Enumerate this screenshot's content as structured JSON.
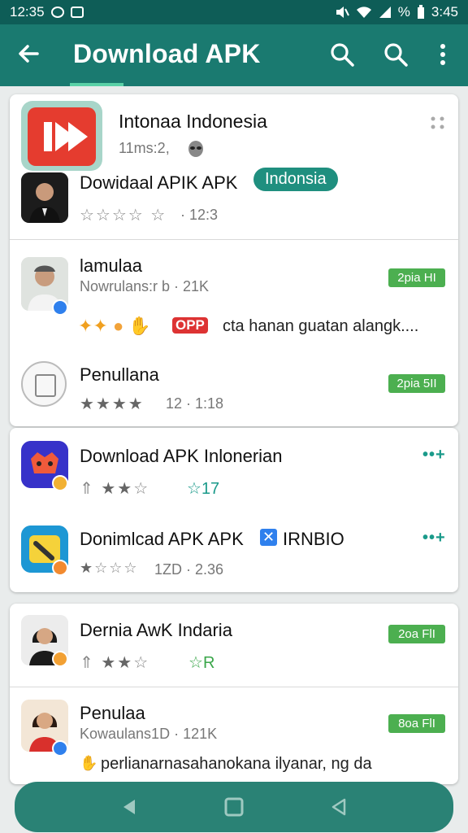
{
  "status": {
    "time": "12:35",
    "right_time": "3:45",
    "battery_label": "%"
  },
  "appbar": {
    "title": "Download APK"
  },
  "card1": {
    "app_title": "Intonaa Indonesia",
    "app_meta": "11ms:2,",
    "row1_title": "Dowidaal APIK APK",
    "row1_pill": "Indonsia",
    "row1_rating": "· 12:3"
  },
  "card1b": {
    "row2_title": "lamulaa",
    "row2_sub": "Nowrulans:r b · 21K",
    "row2_badge": "2pia HI",
    "row2_emoji_text": "cta hanan guatan alangk....",
    "row2_emoji_tag": "OPP",
    "row3_title": "Penullana",
    "row3_badge": "2pia 5II",
    "row3_rating": "12 · 1:18"
  },
  "card2": {
    "row1_title": "Download APK Inlonerian",
    "row1_rating": "17",
    "row2_title": "Donimlcad APK APK",
    "row2_tag": "IRNBIO",
    "row2_rating": "1ZD · 2.36"
  },
  "card3": {
    "row1_title": "Dernia AwK Indaria",
    "row1_badge": "2oa FlI",
    "row1_rating": "R",
    "row2_title": "Penulaa",
    "row2_sub": "Kowaulans1D · 121K",
    "row2_badge": "8oa FlI",
    "row2_body": "perlianarnasahanokana ilyanar, ng da"
  }
}
